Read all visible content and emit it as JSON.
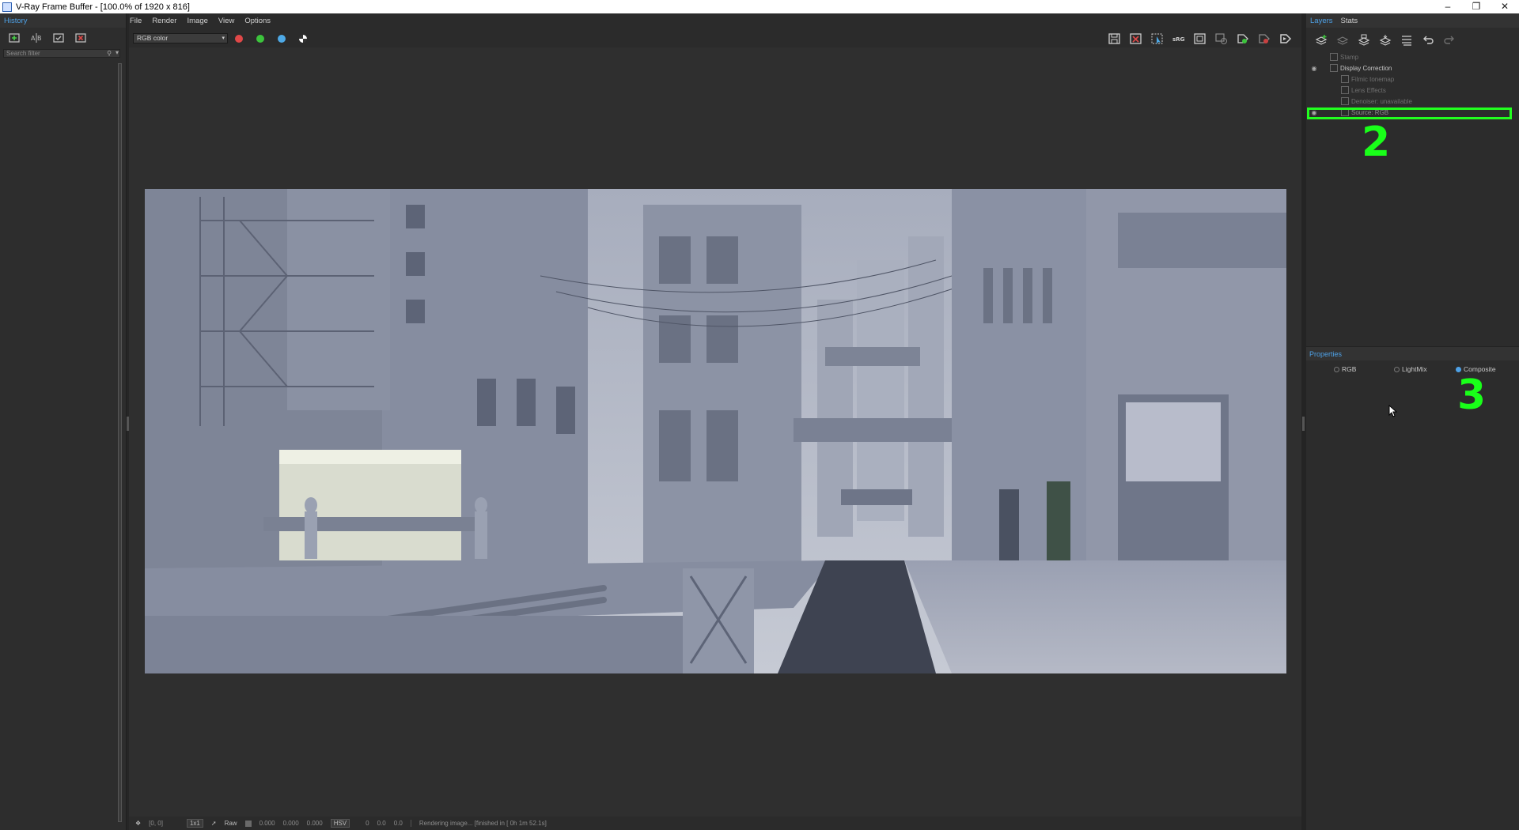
{
  "window": {
    "title": "V-Ray Frame Buffer - [100.0% of 1920 x 816]",
    "controls": [
      "–",
      "❐",
      "✕"
    ]
  },
  "history_panel": {
    "tab": "History",
    "search_placeholder": "Search filter",
    "tools": [
      "load-history-icon",
      "compare-ab-icon",
      "save-history-icon",
      "remove-history-icon"
    ]
  },
  "menu": [
    "File",
    "Render",
    "Image",
    "View",
    "Options"
  ],
  "toolbar": {
    "channel": "RGB color",
    "channel_colors": {
      "red": "#e04848",
      "green": "#3cc43c",
      "blue": "#4ea9e6"
    },
    "right_tools": [
      "save-image-icon",
      "clear-image-icon",
      "track-mouse-icon",
      "sRGB-icon",
      "region-render-icon",
      "lens-effects-icon",
      "interactive-render-icon",
      "stop-render-icon",
      "render-icon"
    ]
  },
  "layers_panel": {
    "tabs": [
      "Layers",
      "Stats"
    ],
    "tools": [
      "add-layer-icon",
      "remove-layer-icon",
      "save-layers-icon",
      "load-layers-icon",
      "layer-list-icon",
      "undo-icon",
      "redo-icon"
    ],
    "tree": [
      {
        "label": "Stamp",
        "indent": 1,
        "eye": false,
        "state": "dim"
      },
      {
        "label": "Display Correction",
        "indent": 1,
        "eye": true,
        "state": "normal"
      },
      {
        "label": "Filmic tonemap",
        "indent": 2,
        "eye": false,
        "state": "dim"
      },
      {
        "label": "Lens Effects",
        "indent": 2,
        "eye": false,
        "state": "dim"
      },
      {
        "label": "Denoiser: unavailable",
        "indent": 2,
        "eye": false,
        "state": "dim"
      },
      {
        "label": "Source: RGB",
        "indent": 2,
        "eye": true,
        "state": "selected"
      }
    ],
    "marker_2": "2"
  },
  "properties": {
    "header": "Properties",
    "options": [
      {
        "label": "RGB",
        "selected": false
      },
      {
        "label": "LightMix",
        "selected": false
      },
      {
        "label": "Composite",
        "selected": true
      }
    ],
    "marker_3": "3"
  },
  "statusbar": {
    "coords": "[0, 0]",
    "zoom": "1x1",
    "mode": "Raw",
    "values": [
      "0.000",
      "0.000",
      "0.000"
    ],
    "color_space": "HSV",
    "hsv": [
      "0",
      "0.0",
      "0.0"
    ],
    "status": "Rendering image... [finished in [ 0h  1m 52.1s]"
  }
}
